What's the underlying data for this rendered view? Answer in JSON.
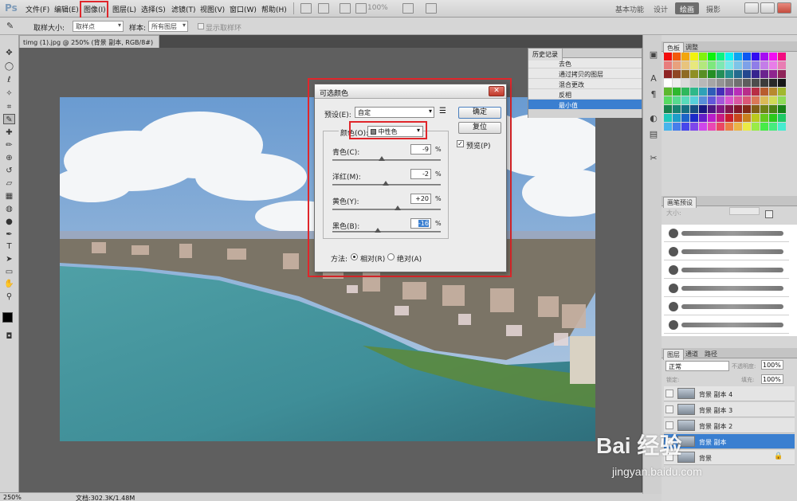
{
  "app": {
    "logo": "Ps"
  },
  "menu": [
    "文件(F)",
    "编辑(E)",
    "图像(I)",
    "图层(L)",
    "选择(S)",
    "滤镜(T)",
    "视图(V)",
    "窗口(W)",
    "帮助(H)"
  ],
  "toolbar": {
    "zoom_value": "100%"
  },
  "workspaces": [
    "基本功能",
    "设计",
    "绘画",
    "摄影"
  ],
  "workspace_active": "绘画",
  "options": {
    "sample_size_label": "取样大小:",
    "sample_size_value": "取样点",
    "sample_label": "样本:",
    "sample_value": "所有图层",
    "show_ring_label": "显示取样环"
  },
  "document": {
    "tab_title": "timg (1).jpg @ 250% (背景 副本, RGB/8#) *",
    "close": "×"
  },
  "status": {
    "zoom": "250%",
    "doc_info": "文档:302.3K/1.48M"
  },
  "history": {
    "tab": "历史记录",
    "items": [
      "去色",
      "通过拷贝的图层",
      "混合更改",
      "反相",
      "最小值"
    ],
    "selected_index": 4
  },
  "swatches": {
    "tabs": [
      "色板",
      "调整"
    ]
  },
  "brushes": {
    "tab": "画笔预设",
    "size_label": "大小:"
  },
  "layers": {
    "tabs": [
      "图层",
      "通道",
      "路径"
    ],
    "blend_mode": "正常",
    "opacity_label": "不透明度:",
    "opacity_value": "100%",
    "lock_label": "锁定:",
    "fill_label": "填充:",
    "fill_value": "100%",
    "items": [
      "背景 副本 4",
      "背景 副本 3",
      "背景 副本 2",
      "背景 副本",
      "背景"
    ],
    "selected_index": 3
  },
  "dialog": {
    "title": "可选颜色",
    "close": "✕",
    "preset_label": "预设(E):",
    "preset_value": "自定",
    "color_label": "颜色(O):",
    "color_value": "中性色",
    "ok": "确定",
    "reset": "复位",
    "preview_label": "预览(P)",
    "sliders": [
      {
        "label": "青色(C):",
        "value": "-9",
        "level": -9
      },
      {
        "label": "洋红(M):",
        "value": "-2",
        "level": -2
      },
      {
        "label": "黄色(Y):",
        "value": "+20",
        "level": 20
      },
      {
        "label": "黑色(B):",
        "value": "-16",
        "level": -16
      }
    ],
    "percent": "%",
    "method_label": "方法:",
    "relative_label": "相对(R)",
    "absolute_label": "绝对(A)"
  },
  "watermark": {
    "main": "Bai 经验",
    "sub": "jingyan.baidu.com"
  },
  "colors": {
    "accent": "#3a7fd0",
    "highlight_box": "#e0262b"
  }
}
